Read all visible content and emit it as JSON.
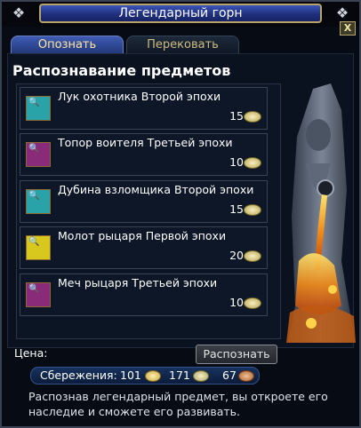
{
  "window": {
    "title": "Легендарный горн",
    "close_label": "X"
  },
  "tabs": [
    {
      "label": "Опознать"
    },
    {
      "label": "Перековать"
    }
  ],
  "section": {
    "title": "Распознавание предметов"
  },
  "items": [
    {
      "name": "Лук охотника Второй эпохи",
      "cost": "15",
      "icon": "bow-icon",
      "color": "#2aa3a8"
    },
    {
      "name": "Топор воителя Третьей эпохи",
      "cost": "10",
      "icon": "axe-icon",
      "color": "#8a2b7a"
    },
    {
      "name": "Дубина взломщика Второй эпохи",
      "cost": "15",
      "icon": "club-icon",
      "color": "#2aa3a8"
    },
    {
      "name": "Молот рыцаря Первой эпохи",
      "cost": "20",
      "icon": "hammer-icon",
      "color": "#d8c81e"
    },
    {
      "name": "Меч рыцаря Третьей эпохи",
      "cost": "10",
      "icon": "sword-icon",
      "color": "#8a2b7a"
    }
  ],
  "price_label": "Цена:",
  "identify_button": "Распознать",
  "savings": {
    "label": "Сбережения:",
    "gold": "101",
    "silver": "171",
    "copper": "67"
  },
  "info_text": "Распознав легендарный предмет, вы откроете его наследие и сможете его развивать."
}
